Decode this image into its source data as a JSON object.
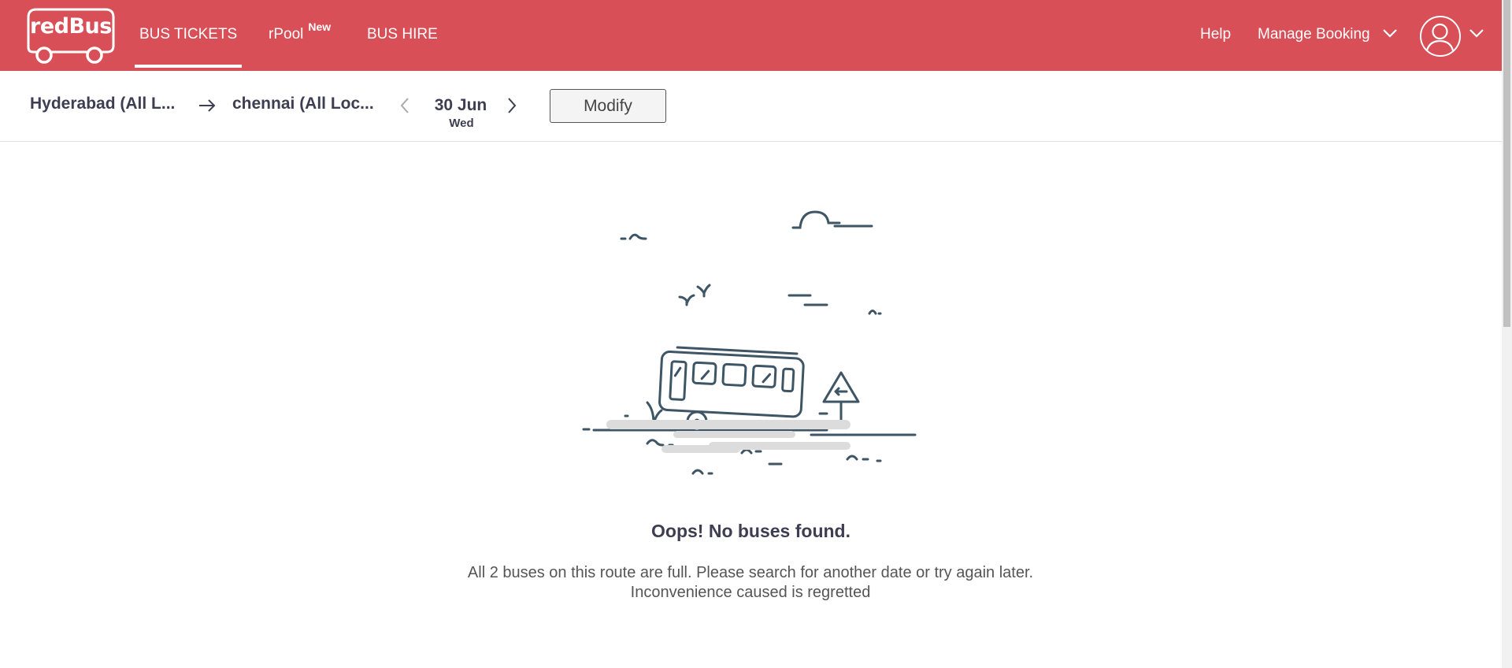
{
  "header": {
    "logo_text": "redBus",
    "nav": {
      "bus_tickets": "BUS TICKETS",
      "rpool": "rPool",
      "rpool_badge": "New",
      "bus_hire": "BUS HIRE"
    },
    "help": "Help",
    "manage_booking": "Manage Booking"
  },
  "search": {
    "from": "Hyderabad (All L...",
    "to": "chennai (All Loc...",
    "date": "30 Jun",
    "day": "Wed",
    "modify_label": "Modify"
  },
  "result": {
    "title": "Oops! No buses found.",
    "message": "All 2 buses on this route are full. Please search for another date or try again later. Inconvenience caused is regretted"
  },
  "colors": {
    "brand": "#d84f57",
    "illustration_stroke": "#3e5566",
    "link": "#e6a21c"
  }
}
